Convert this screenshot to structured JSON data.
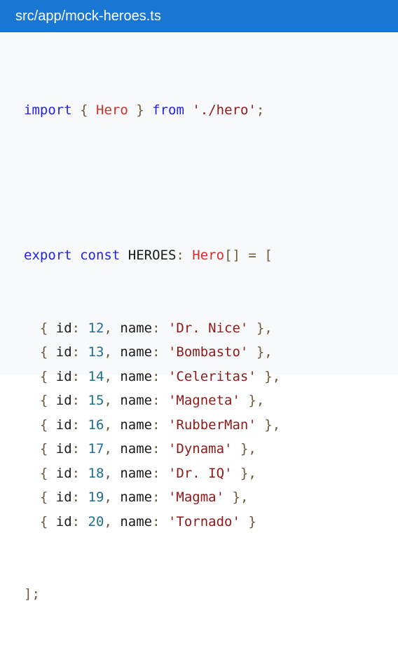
{
  "header": {
    "file_path": "src/app/mock-heroes.ts"
  },
  "code": {
    "import_keyword": "import",
    "import_open": "{",
    "import_name": "Hero",
    "import_close": "}",
    "from_keyword": "from",
    "import_path": "'./hero'",
    "import_semicolon": ";",
    "export_keyword": "export",
    "const_keyword": "const",
    "const_name": "HEROES",
    "colon": ":",
    "type_name": "Hero",
    "array_brackets": "[]",
    "equals": "=",
    "array_open": "[",
    "array_close": "];",
    "heroes": [
      {
        "id": "12",
        "name": "'Dr. Nice'"
      },
      {
        "id": "13",
        "name": "'Bombasto'"
      },
      {
        "id": "14",
        "name": "'Celeritas'"
      },
      {
        "id": "15",
        "name": "'Magneta'"
      },
      {
        "id": "16",
        "name": "'RubberMan'"
      },
      {
        "id": "17",
        "name": "'Dynama'"
      },
      {
        "id": "18",
        "name": "'Dr. IQ'"
      },
      {
        "id": "19",
        "name": "'Magma'"
      },
      {
        "id": "20",
        "name": "'Tornado'"
      }
    ],
    "colors": {
      "header_bg": "#1976d2",
      "keyword": "#2323e6",
      "type": "#d32f2f",
      "string": "#8c1a1a",
      "number": "#1f6e8c"
    }
  }
}
